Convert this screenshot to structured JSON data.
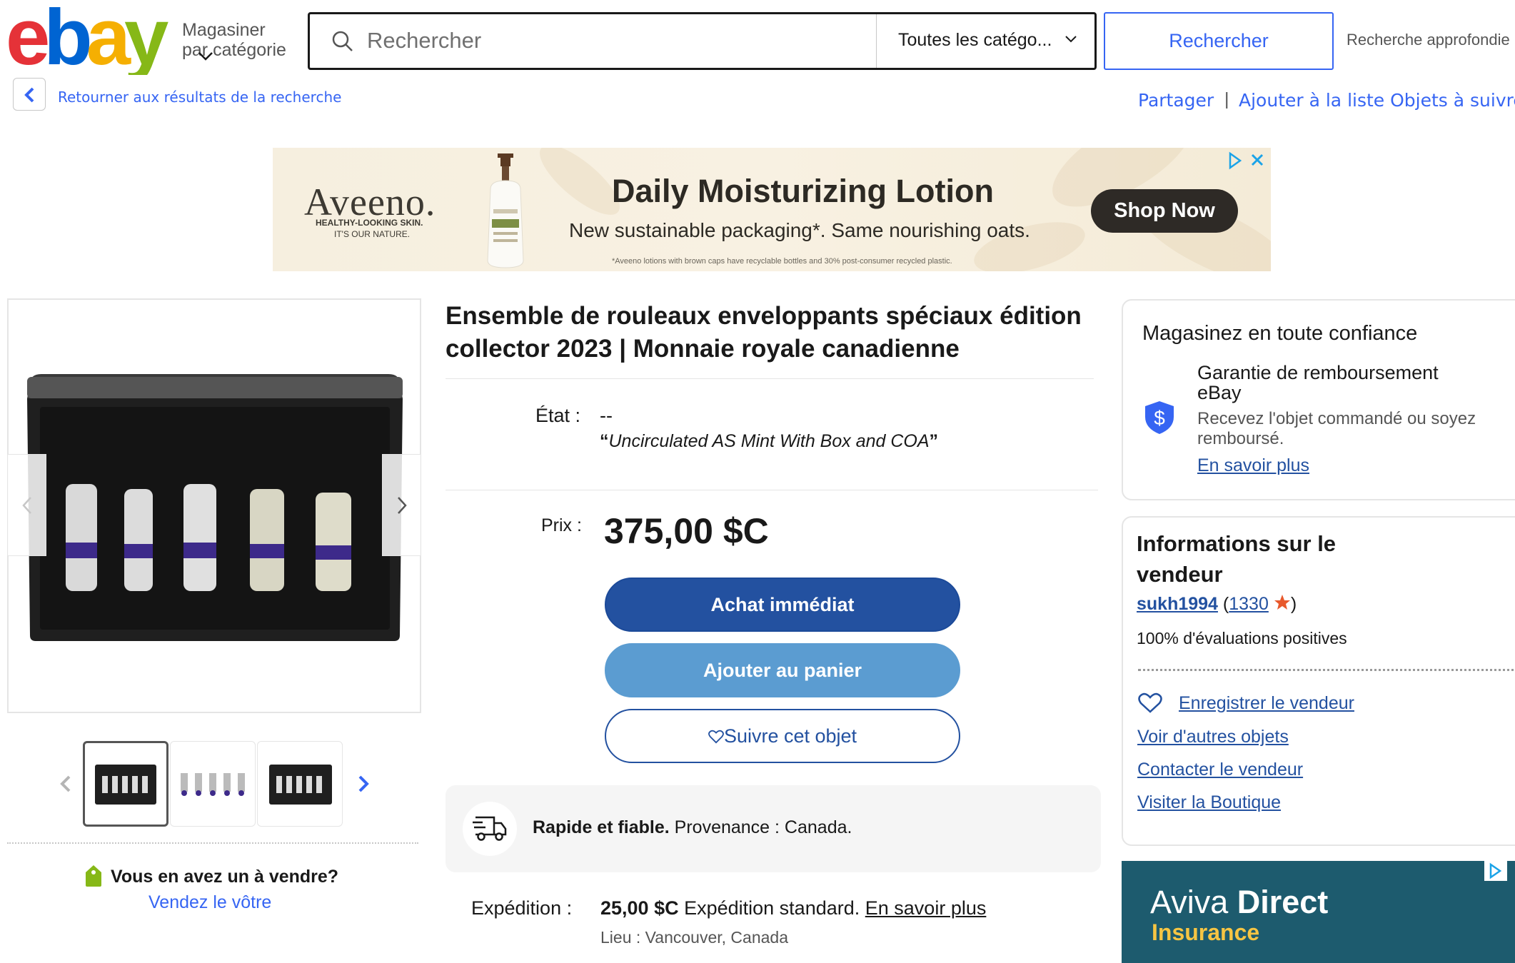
{
  "header": {
    "logo_text": "ebay",
    "shop_by_category": [
      "Magasiner",
      "par catégorie"
    ],
    "search_placeholder": "Rechercher",
    "category_select": "Toutes les catégo...",
    "search_button": "Rechercher",
    "advanced_search": "Recherche approfondie"
  },
  "subnav": {
    "back_link": "Retourner aux résultats de la recherche",
    "share": "Partager",
    "separator": "|",
    "watchlist": "Ajouter à la liste Objets à suivre"
  },
  "ad_banner": {
    "brand": "Aveeno.",
    "tagline_1": "HEALTHY-LOOKING SKIN.",
    "tagline_2": "IT'S OUR NATURE.",
    "headline": "Daily Moisturizing Lotion",
    "subline": "New sustainable packaging*. Same nourishing oats.",
    "fineprint": "*Aveeno lotions with brown caps have recyclable bottles and 30% post-consumer recycled plastic.",
    "cta": "Shop Now"
  },
  "gallery": {
    "thumbnail_count": 3,
    "active_index": 0
  },
  "sell_promo": {
    "question": "Vous en avez un à vendre?",
    "link": "Vendez le vôtre"
  },
  "listing": {
    "title": "Ensemble de rouleaux enveloppants spéciaux édition collector 2023 | Monnaie royale canadienne",
    "condition_label": "État :",
    "condition_value": "--",
    "condition_quote_open": "“",
    "condition_quote": "Uncirculated AS Mint With Box and COA",
    "condition_quote_close": "”",
    "price_label": "Prix :",
    "price": "375,00 $C",
    "buy_now": "Achat immédiat",
    "add_to_cart": "Ajouter au panier",
    "watch": "Suivre cet objet",
    "fast_bold": "Rapide et fiable.",
    "fast_text": " Provenance : Canada.",
    "shipping_label": "Expédition :",
    "shipping_cost": "25,00 $C",
    "shipping_method": " Expédition standard. ",
    "shipping_learn_more": "En savoir plus",
    "location": "Lieu : Vancouver, Canada"
  },
  "trust": {
    "title": "Magasinez en toute confiance",
    "guarantee_title": "Garantie de remboursement eBay",
    "guarantee_desc": "Recevez l'objet commandé ou soyez remboursé.",
    "learn_more": "En savoir plus"
  },
  "seller": {
    "title": "Informations sur le vendeur",
    "name": "sukh1994",
    "paren_open": " (",
    "feedback_count": "1330",
    "paren_close": ")",
    "positive": "100% d'évaluations positives",
    "save_seller": "Enregistrer le vendeur",
    "links": [
      "Voir d'autres objets",
      "Contacter le vendeur",
      "Visiter la Boutique"
    ]
  },
  "side_ad": {
    "brand_light": "Aviva ",
    "brand_bold": "Direct",
    "product": "Insurance"
  },
  "colors": {
    "ebay_red": "#e53238",
    "ebay_blue": "#0064d2",
    "ebay_yellow": "#f5af02",
    "ebay_green": "#86b817",
    "link_blue": "#3665f3",
    "buy_button": "#2351a0",
    "cart_button": "#5b9cd1"
  }
}
